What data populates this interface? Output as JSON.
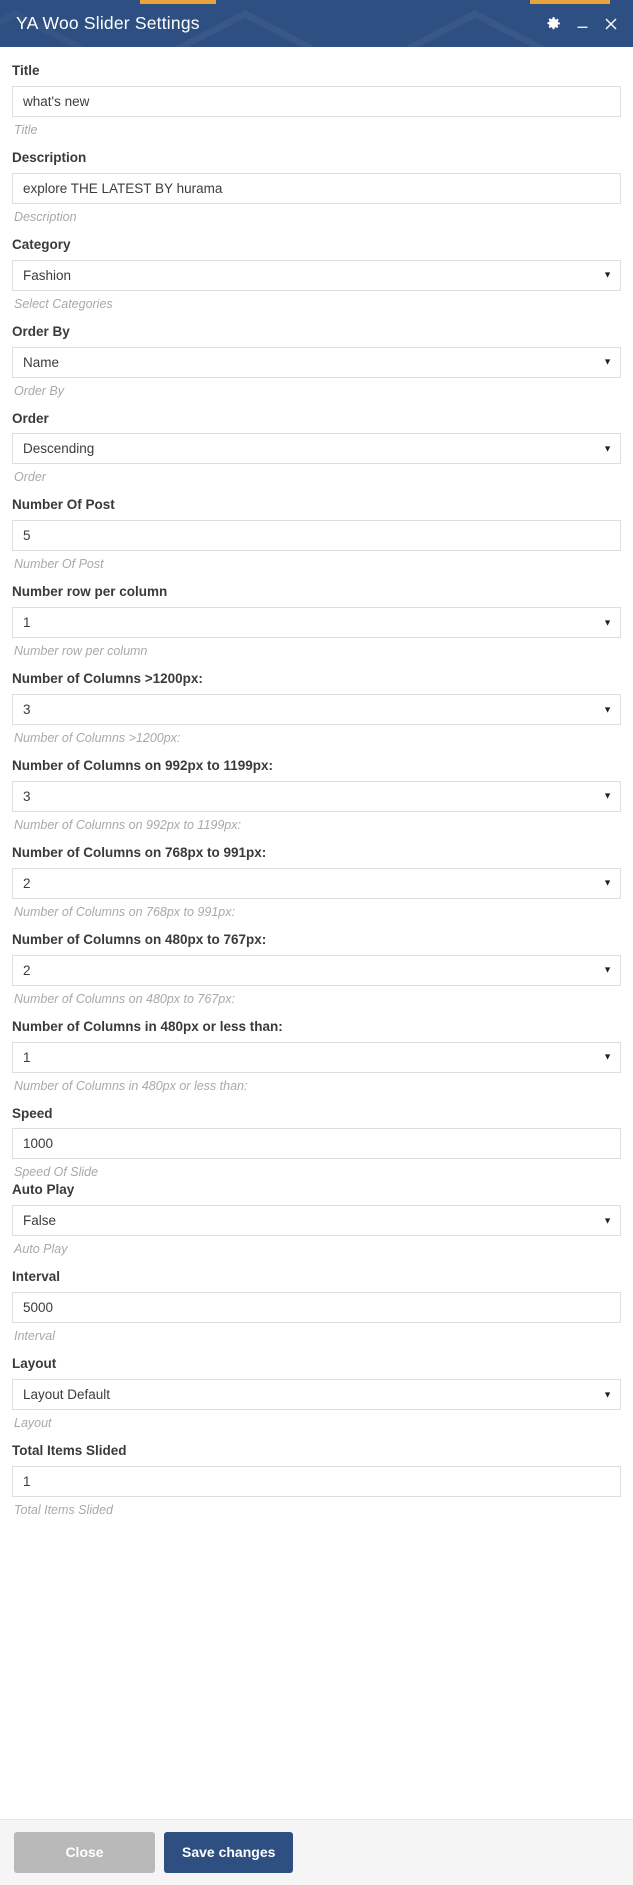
{
  "window": {
    "title": "YA Woo Slider Settings",
    "accent_color": "#2e4f82",
    "actions": [
      {
        "name": "settings-gear",
        "icon": "gear-icon"
      },
      {
        "name": "minimize",
        "icon": "minimize-icon"
      },
      {
        "name": "close",
        "icon": "close-icon"
      }
    ]
  },
  "form": {
    "fields": [
      {
        "label": "Title",
        "type": "text",
        "value": "what's new",
        "help": "Title"
      },
      {
        "label": "Description",
        "type": "text",
        "value": "explore THE LATEST BY hurama",
        "help": "Description"
      },
      {
        "label": "Category",
        "type": "select",
        "value": "Fashion",
        "help": "Select Categories"
      },
      {
        "label": "Order By",
        "type": "select",
        "value": "Name",
        "help": "Order By"
      },
      {
        "label": "Order",
        "type": "select",
        "value": "Descending",
        "help": "Order"
      },
      {
        "label": "Number Of Post",
        "type": "text",
        "value": "5",
        "help": "Number Of Post"
      },
      {
        "label": "Number row per column",
        "type": "select",
        "value": "1",
        "help": "Number row per column"
      },
      {
        "label": "Number of Columns >1200px:",
        "type": "select",
        "value": "3",
        "help": "Number of Columns >1200px:"
      },
      {
        "label": "Number of Columns on 992px to 1199px:",
        "type": "select",
        "value": "3",
        "help": "Number of Columns on 992px to 1199px:"
      },
      {
        "label": "Number of Columns on 768px to 991px:",
        "type": "select",
        "value": "2",
        "help": "Number of Columns on 768px to 991px:"
      },
      {
        "label": "Number of Columns on 480px to 767px:",
        "type": "select",
        "value": "2",
        "help": "Number of Columns on 480px to 767px:"
      },
      {
        "label": "Number of Columns in 480px or less than:",
        "type": "select",
        "value": "1",
        "help": "Number of Columns in 480px or less than:"
      },
      {
        "label": "Speed",
        "type": "text",
        "value": "1000",
        "help": "Speed Of Slide",
        "help_tight": true
      },
      {
        "label": "Auto Play",
        "type": "select",
        "value": "False",
        "help": "Auto Play"
      },
      {
        "label": "Interval",
        "type": "text",
        "value": "5000",
        "help": "Interval"
      },
      {
        "label": "Layout",
        "type": "select",
        "value": "Layout Default",
        "help": "Layout"
      },
      {
        "label": "Total Items Slided",
        "type": "text",
        "value": "1",
        "help": "Total Items Slided"
      }
    ]
  },
  "footer": {
    "close_label": "Close",
    "save_label": "Save changes"
  }
}
